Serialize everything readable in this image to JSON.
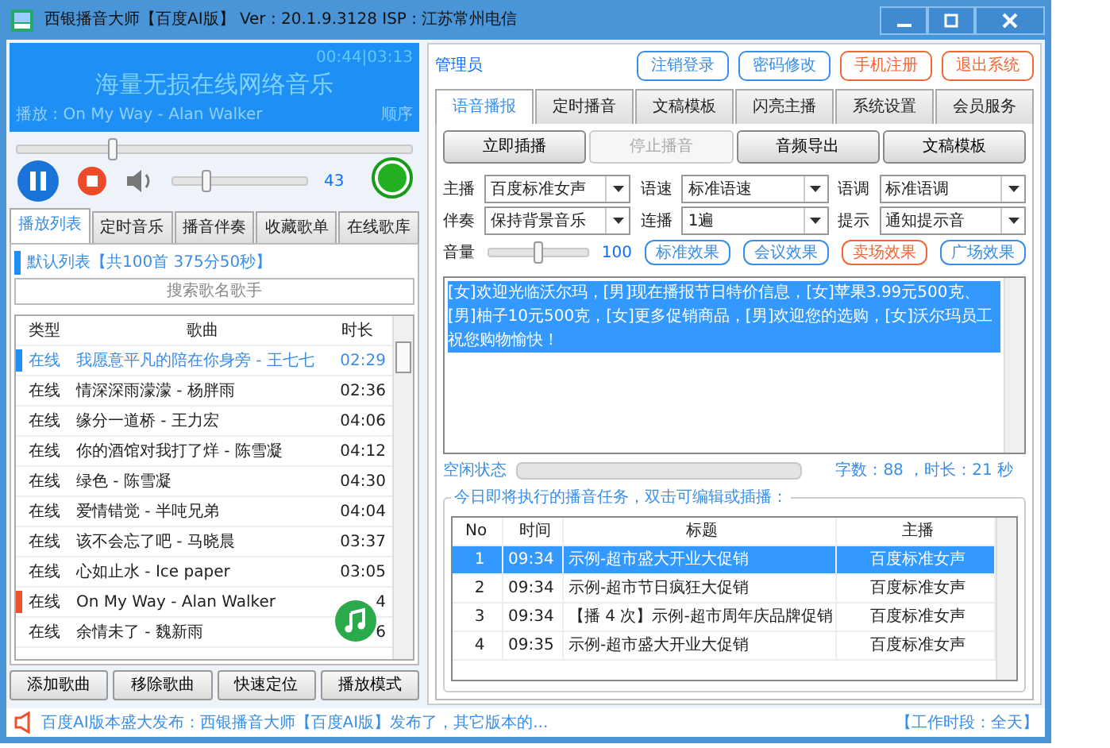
{
  "window": {
    "title": "西银播音大师【百度AI版】 Ver : 20.1.9.3128  ISP : 江苏常州电信"
  },
  "player": {
    "time": "00:44|03:13",
    "headline": "海量无损在线网络音乐",
    "now_playing": "播放 : On My Way - Alan Walker",
    "mode": "顺序",
    "seek": {
      "level": 0.24
    },
    "playing": true,
    "volume": {
      "level": 0.25,
      "text": "43"
    }
  },
  "left_tabs": [
    {
      "label": "播放列表",
      "selected": true
    },
    {
      "label": "定时音乐",
      "selected": false
    },
    {
      "label": "播音伴奏",
      "selected": false
    },
    {
      "label": "收藏歌单",
      "selected": false
    },
    {
      "label": "在线歌库",
      "selected": false
    }
  ],
  "playlist": {
    "title": "默认列表【共100首 375分50秒】",
    "search_placeholder": "搜索歌名歌手",
    "columns": [
      "类型",
      "歌曲",
      "时长"
    ],
    "rows": [
      {
        "type": "在线",
        "song": "我愿意平凡的陪在你身旁 - 王七七",
        "duration": "02:29",
        "selected": true,
        "playing": false
      },
      {
        "type": "在线",
        "song": "情深深雨濛濛 - 杨胖雨",
        "duration": "02:36",
        "selected": false,
        "playing": false
      },
      {
        "type": "在线",
        "song": "缘分一道桥 - 王力宏",
        "duration": "04:06",
        "selected": false,
        "playing": false
      },
      {
        "type": "在线",
        "song": "你的酒馆对我打了烊 - 陈雪凝",
        "duration": "04:12",
        "selected": false,
        "playing": false
      },
      {
        "type": "在线",
        "song": "绿色 - 陈雪凝",
        "duration": "04:30",
        "selected": false,
        "playing": false
      },
      {
        "type": "在线",
        "song": "爱情错觉 - 半吨兄弟",
        "duration": "04:04",
        "selected": false,
        "playing": false
      },
      {
        "type": "在线",
        "song": "该不会忘了吧 - 马晓晨",
        "duration": "03:37",
        "selected": false,
        "playing": false
      },
      {
        "type": "在线",
        "song": "心如止水 - Ice paper",
        "duration": "03:05",
        "selected": false,
        "playing": false
      },
      {
        "type": "在线",
        "song": "On My Way - Alan Walker",
        "duration": "4",
        "selected": false,
        "playing": true
      },
      {
        "type": "在线",
        "song": "余情未了 - 魏新雨",
        "duration": "6",
        "selected": false,
        "playing": false
      }
    ],
    "buttons": [
      "添加歌曲",
      "移除歌曲",
      "快速定位",
      "播放模式"
    ]
  },
  "status_bar": {
    "announcement": "百度AI版本盛大发布：西银播音大师【百度AI版】发布了，其它版本的...",
    "work_time": "【工作时段：全天】"
  },
  "user": "管理员",
  "header_buttons": [
    {
      "label": "注销登录",
      "color": "#3a8ee6"
    },
    {
      "label": "密码修改",
      "color": "#3a8ee6"
    },
    {
      "label": "手机注册",
      "color": "#f0683a"
    },
    {
      "label": "退出系统",
      "color": "#f0683a"
    }
  ],
  "tabs": [
    {
      "label": "语音播报",
      "selected": true
    },
    {
      "label": "定时播音",
      "selected": false
    },
    {
      "label": "文稿模板",
      "selected": false
    },
    {
      "label": "闪亮主播",
      "selected": false
    },
    {
      "label": "系统设置",
      "selected": false
    },
    {
      "label": "会员服务",
      "selected": false
    }
  ],
  "actions": [
    {
      "label": "立即插播",
      "disabled": false
    },
    {
      "label": "停止播音",
      "disabled": true
    },
    {
      "label": "音频导出",
      "disabled": false
    },
    {
      "label": "文稿模板",
      "disabled": false
    }
  ],
  "settings": [
    {
      "label": "主播",
      "value": "百度标准女声"
    },
    {
      "label": "语速",
      "value": "标准语速"
    },
    {
      "label": "语调",
      "value": "标准语调"
    },
    {
      "label": "伴奏",
      "value": "保持背景音乐"
    },
    {
      "label": "连播",
      "value": "1遍"
    },
    {
      "label": "提示",
      "value": "通知提示音"
    }
  ],
  "volume": {
    "label": "音量",
    "level": 0.5,
    "text": "100"
  },
  "effects": [
    {
      "label": "标准效果",
      "selected": false
    },
    {
      "label": "会议效果",
      "selected": false
    },
    {
      "label": "卖场效果",
      "selected": true
    },
    {
      "label": "广场效果",
      "selected": false
    }
  ],
  "script": {
    "text": "[女]欢迎光临沃尔玛，[男]现在播报节日特价信息，[女]苹果3.99元500克、[男]柚子10元500克，[女]更多促销商品，[男]欢迎您的选购，[女]沃尔玛员工祝您购物愉快！",
    "selected": true
  },
  "broadcast": {
    "state": "空闲状态",
    "level": 0,
    "info": "字数：88 ，时长：21 秒"
  },
  "tasks": {
    "legend": "今日即将执行的播音任务，双击可编辑或插播：",
    "columns": [
      "No",
      "时间",
      "标题",
      "主播"
    ],
    "rows": [
      {
        "no": "1",
        "time": "09:34",
        "title": "示例-超市盛大开业大促销",
        "anchor": "百度标准女声",
        "selected": true
      },
      {
        "no": "2",
        "time": "09:34",
        "title": "示例-超市节日疯狂大促销",
        "anchor": "百度标准女声",
        "selected": false
      },
      {
        "no": "3",
        "time": "09:34",
        "title": "【播 4 次】示例-超市周年庆品牌促销",
        "anchor": "百度标准女声",
        "selected": false
      },
      {
        "no": "4",
        "time": "09:35",
        "title": "示例-超市盛大开业大促销",
        "anchor": "百度标准女声",
        "selected": false
      }
    ]
  }
}
